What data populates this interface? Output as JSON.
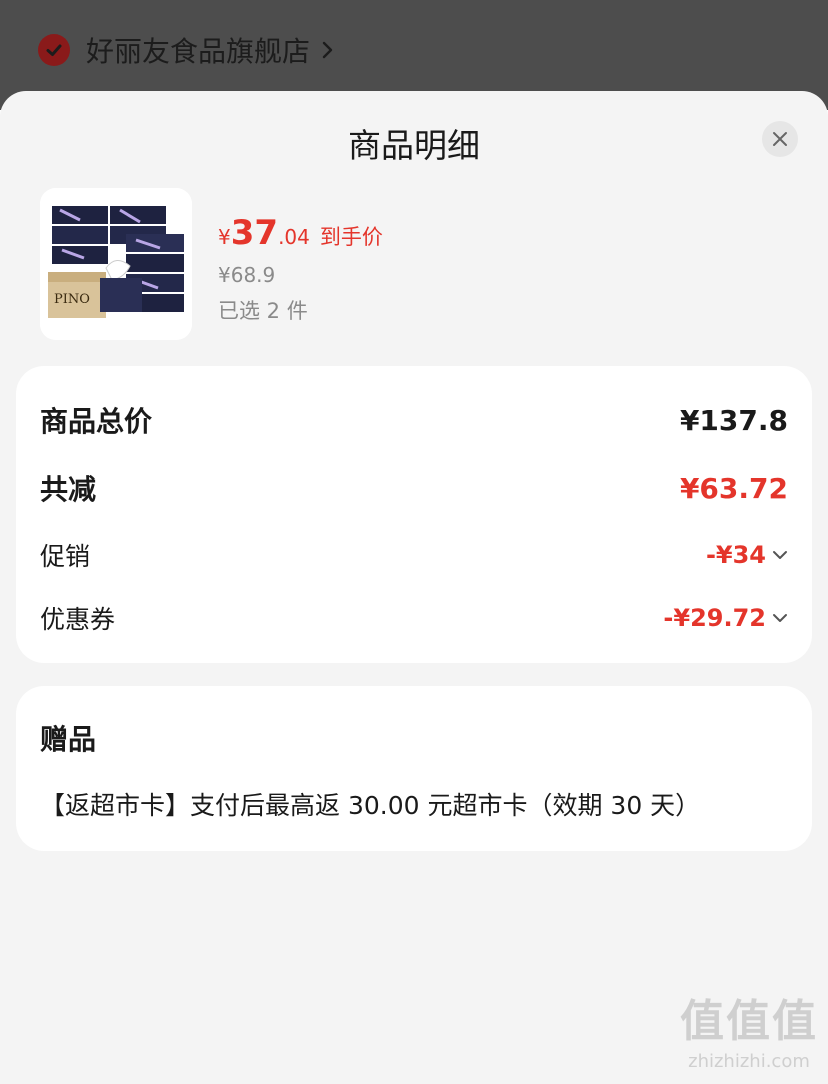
{
  "store": {
    "name": "好丽友食品旗舰店"
  },
  "sheet": {
    "title": "商品明细"
  },
  "product": {
    "price_symbol": "¥",
    "price_int": "37",
    "price_dec": ".04",
    "price_note": "到手价",
    "original_price": "¥68.9",
    "selected": "已选 2 件",
    "image_brand_text": "PINO"
  },
  "summary": {
    "total_label": "商品总价",
    "total_value": "¥137.8",
    "discount_label": "共减",
    "discount_value": "¥63.72",
    "promo_label": "促销",
    "promo_value": "-¥34",
    "coupon_label": "优惠券",
    "coupon_value": "-¥29.72"
  },
  "gift": {
    "title": "赠品",
    "text": "【返超市卡】支付后最高返 30.00 元超市卡（效期 30 天）"
  },
  "watermark": {
    "big": "值值值",
    "small": "zhizhizhi.com"
  },
  "colors": {
    "accent": "#e4352b",
    "check": "#8a1a1a",
    "sheet_bg": "#f4f4f4"
  },
  "icons": [
    "check-circle-icon",
    "chevron-right-icon",
    "close-icon",
    "chevron-down-icon"
  ]
}
